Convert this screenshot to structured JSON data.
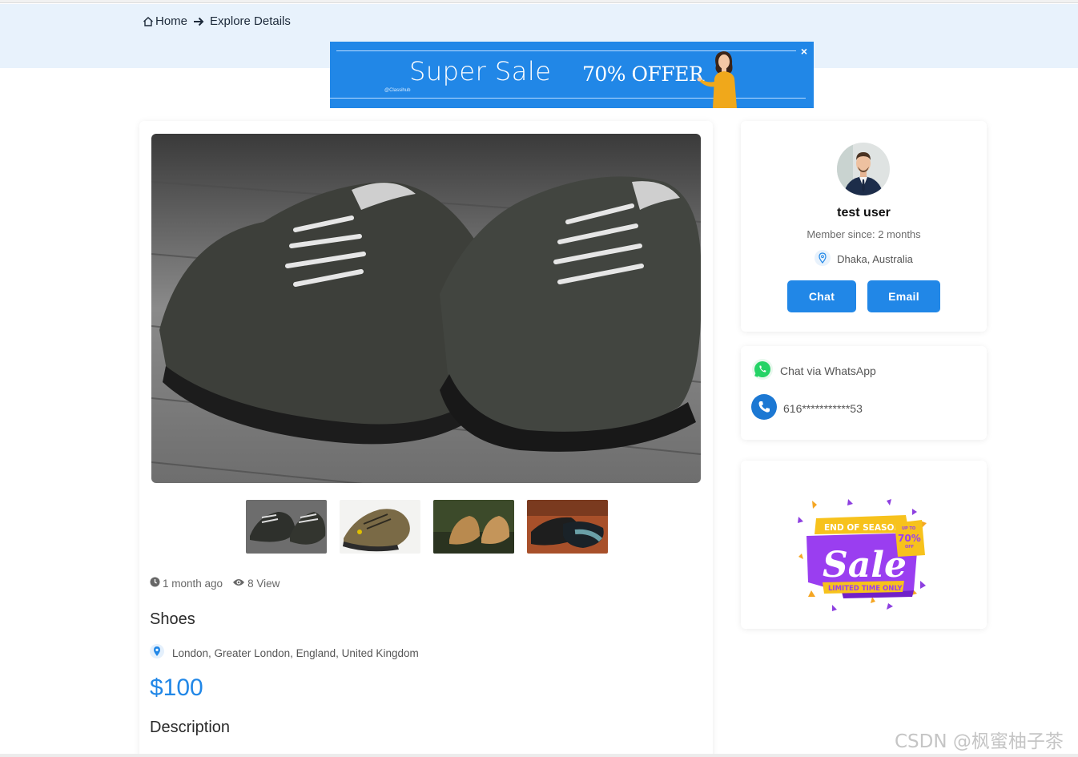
{
  "breadcrumb": {
    "home": "Home",
    "current": "Explore Details"
  },
  "banner": {
    "headline": "Super Sale",
    "offer": "70% OFFER",
    "brand": "@Classihub",
    "close": "×"
  },
  "listing": {
    "posted": "1 month ago",
    "views": "8 View",
    "title": "Shoes",
    "location": "London, Greater London, England, United Kingdom",
    "price": "$100",
    "description_heading": "Description",
    "thumbnails": [
      "grey sneakers",
      "brown hiking shoe",
      "tan boots on grass",
      "leather dress shoes"
    ]
  },
  "seller": {
    "name": "test user",
    "member_since": "Member since: 2 months",
    "location": "Dhaka, Australia",
    "chat_label": "Chat",
    "email_label": "Email"
  },
  "contact": {
    "whatsapp": "Chat via WhatsApp",
    "phone": "616***********53"
  },
  "ad": {
    "top": "END OF SEASON",
    "main": "Sale",
    "badge_top": "UP TO",
    "badge": "70%",
    "badge_bottom": "OFF",
    "bottom": "LIMITED TIME ONLY"
  },
  "watermark": "CSDN @枫蜜柚子茶",
  "colors": {
    "accent": "#2187e7",
    "band": "#e8f2fc",
    "whatsapp": "#25d366"
  }
}
